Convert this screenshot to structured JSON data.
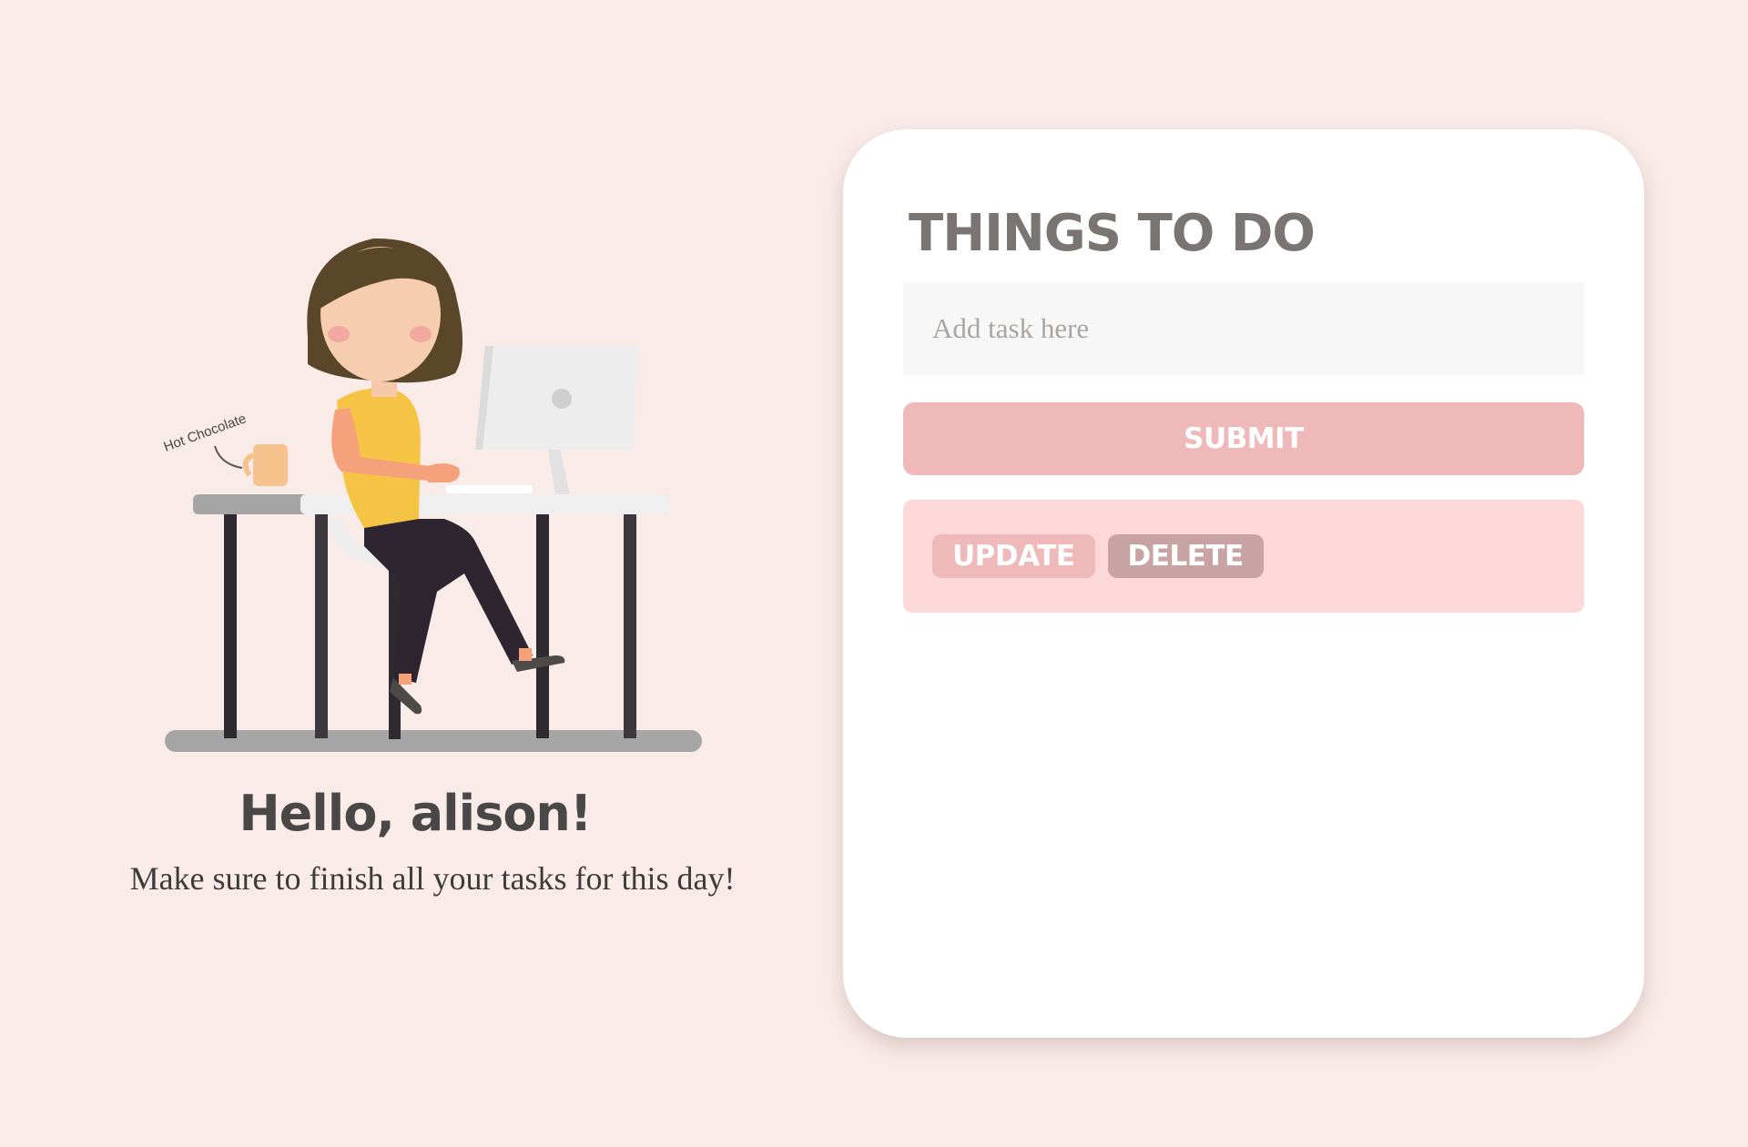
{
  "illustration": {
    "mug_label": "Hot Chocolate"
  },
  "greeting": {
    "title": "Hello, alison!",
    "subtitle": "Make sure to finish all your tasks for this day!"
  },
  "todo": {
    "title": "THINGS TO DO",
    "input_placeholder": "Add task here",
    "input_value": "",
    "submit_label": "SUBMIT",
    "task_item": {
      "text": "",
      "update_label": "UPDATE",
      "delete_label": "DELETE"
    }
  },
  "colors": {
    "background": "#f8ebe8",
    "card": "#ffffff",
    "submit": "#f0b9b9",
    "task_row": "#fdd8d8",
    "update": "#f0b9b9",
    "delete": "#c7a3a3",
    "title_text": "#7a7572"
  }
}
